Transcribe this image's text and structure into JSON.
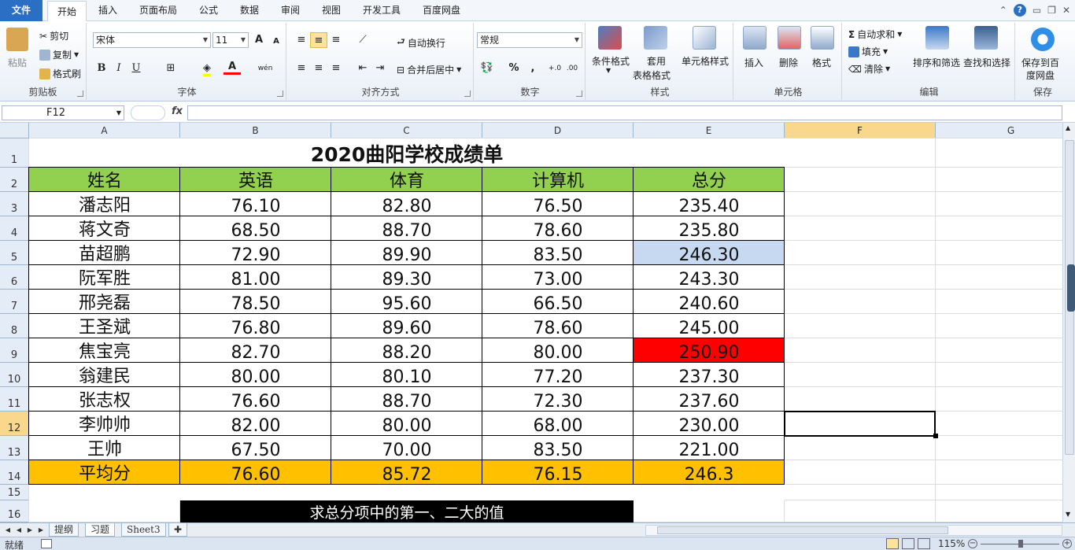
{
  "tabs": [
    "文件",
    "开始",
    "插入",
    "页面布局",
    "公式",
    "数据",
    "审阅",
    "视图",
    "开发工具",
    "百度网盘"
  ],
  "ribbon": {
    "clipboard": {
      "paste": "粘贴",
      "cut": "剪切",
      "copy": "复制",
      "format_painter": "格式刷",
      "label": "剪贴板"
    },
    "font": {
      "name": "宋体",
      "size": "11",
      "bold": "B",
      "italic": "I",
      "underline": "U",
      "grow": "A",
      "shrink": "A",
      "font_color": "A",
      "phonetic": "wén",
      "label": "字体"
    },
    "align": {
      "wrap": "自动换行",
      "merge": "合并后居中",
      "label": "对齐方式"
    },
    "number": {
      "format": "常规",
      "percent": "%",
      "comma": ",",
      "label": "数字"
    },
    "styles": {
      "cond": "条件格式",
      "table1": "套用",
      "table2": "表格格式",
      "cell": "单元格样式",
      "label": "样式"
    },
    "cells": {
      "insert": "插入",
      "delete": "删除",
      "format": "格式",
      "label": "单元格"
    },
    "editing": {
      "autosum": "自动求和",
      "fill": "填充",
      "clear": "清除",
      "sort": "排序和筛选",
      "find": "查找和选择",
      "label": "编辑"
    },
    "save": {
      "line1": "保存到百",
      "line2": "度网盘",
      "label": "保存"
    }
  },
  "formula_bar": {
    "name_box": "F12",
    "fx": "fx",
    "value": ""
  },
  "columns": [
    "A",
    "B",
    "C",
    "D",
    "E",
    "F",
    "G"
  ],
  "rows": [
    "1",
    "2",
    "3",
    "4",
    "5",
    "6",
    "7",
    "8",
    "9",
    "10",
    "11",
    "12",
    "13",
    "14",
    "15",
    "16"
  ],
  "sheet": {
    "title": "2020曲阳学校成绩单",
    "headers": [
      "姓名",
      "英语",
      "体育",
      "计算机",
      "总分"
    ],
    "data": [
      [
        "潘志阳",
        "76.10",
        "82.80",
        "76.50",
        "235.40"
      ],
      [
        "蒋文奇",
        "68.50",
        "88.70",
        "78.60",
        "235.80"
      ],
      [
        "苗超鹏",
        "72.90",
        "89.90",
        "83.50",
        "246.30"
      ],
      [
        "阮军胜",
        "81.00",
        "89.30",
        "73.00",
        "243.30"
      ],
      [
        "邢尧磊",
        "78.50",
        "95.60",
        "66.50",
        "240.60"
      ],
      [
        "王圣斌",
        "76.80",
        "89.60",
        "78.60",
        "245.00"
      ],
      [
        "焦宝亮",
        "82.70",
        "88.20",
        "80.00",
        "250.90"
      ],
      [
        "翁建民",
        "80.00",
        "80.10",
        "77.20",
        "237.30"
      ],
      [
        "张志权",
        "76.60",
        "88.70",
        "72.30",
        "237.60"
      ],
      [
        "李帅帅",
        "82.00",
        "80.00",
        "68.00",
        "230.00"
      ],
      [
        "王帅",
        "67.50",
        "70.00",
        "83.50",
        "221.00"
      ]
    ],
    "average": [
      "平均分",
      "76.60",
      "85.72",
      "76.15",
      "246.3"
    ],
    "note": "求总分项中的第一、二大的值"
  },
  "colors": {
    "header_green": "#92d050",
    "average_orange": "#ffc000",
    "highlight_blue": "#c6d9f1",
    "highlight_red": "#ff0000"
  },
  "sheet_tabs": [
    "提纲",
    "习题",
    "Sheet3"
  ],
  "active_sheet": "习题",
  "status": {
    "ready": "就绪",
    "zoom": "115%"
  }
}
